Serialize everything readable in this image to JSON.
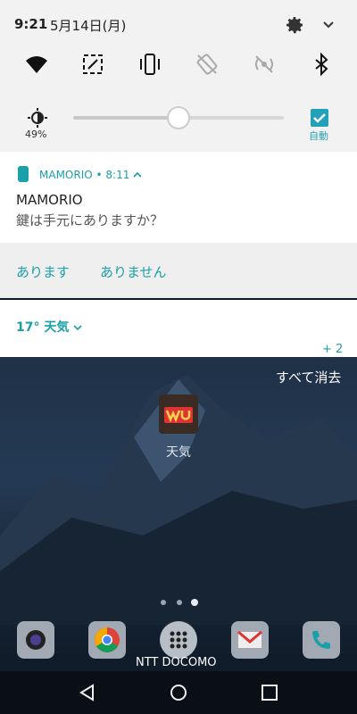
{
  "status": {
    "time": "9:21",
    "date": "5月14日(月)"
  },
  "quick_settings": {
    "icons": [
      "wifi-icon",
      "screen-cast-icon",
      "vibrate-icon",
      "auto-rotate-off-icon",
      "hotspot-off-icon",
      "bluetooth-icon"
    ]
  },
  "brightness": {
    "percent_label": "49%",
    "level": 0.49,
    "auto_label": "自動"
  },
  "notification": {
    "app_name": "MAMORIO",
    "header_sep": " • ",
    "time": "8:11",
    "title": "MAMORIO",
    "body": "鍵は手元にありますか？",
    "actions": [
      "あります",
      "ありません"
    ]
  },
  "weather_notification": {
    "text": "17° 天気"
  },
  "more_count": "+ 2",
  "clear_all": "すべて消去",
  "home": {
    "widget_label": "天気",
    "carrier": "NTT DOCOMO",
    "page_dots": 3,
    "active_page": 3
  },
  "colors": {
    "accent": "#1aa0a8",
    "panel": "#f2f2f2"
  }
}
